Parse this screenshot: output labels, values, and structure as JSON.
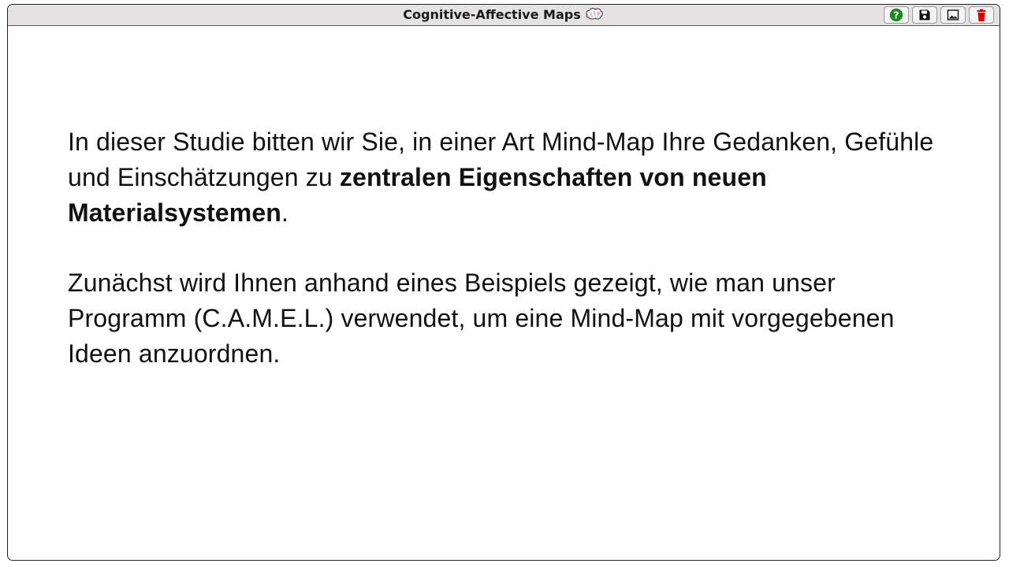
{
  "window": {
    "title": "Cognitive-Affective Maps",
    "icons": [
      "brain-icon"
    ]
  },
  "toolbar": {
    "buttons": [
      {
        "name": "help",
        "icon": "question-circle-icon",
        "color": "#1e8a1e"
      },
      {
        "name": "save",
        "icon": "floppy-disk-icon",
        "color": "#111111"
      },
      {
        "name": "image",
        "icon": "image-icon",
        "color": "#111111"
      },
      {
        "name": "delete",
        "icon": "trash-icon",
        "color": "#e00000"
      }
    ]
  },
  "content": {
    "paragraph1": {
      "before": "In dieser Studie bitten wir Sie, in einer Art Mind-Map Ihre Gedanken, Gefühle und Einschätzungen zu ",
      "bold": "zentralen Eigenschaften von neuen Materialsystemen",
      "after": "."
    },
    "paragraph2": "Zunächst wird Ihnen anhand eines Beispiels gezeigt, wie man unser Programm (C.A.M.E.L.) verwendet, um eine Mind-Map mit vorgegebenen Ideen anzuordnen."
  }
}
